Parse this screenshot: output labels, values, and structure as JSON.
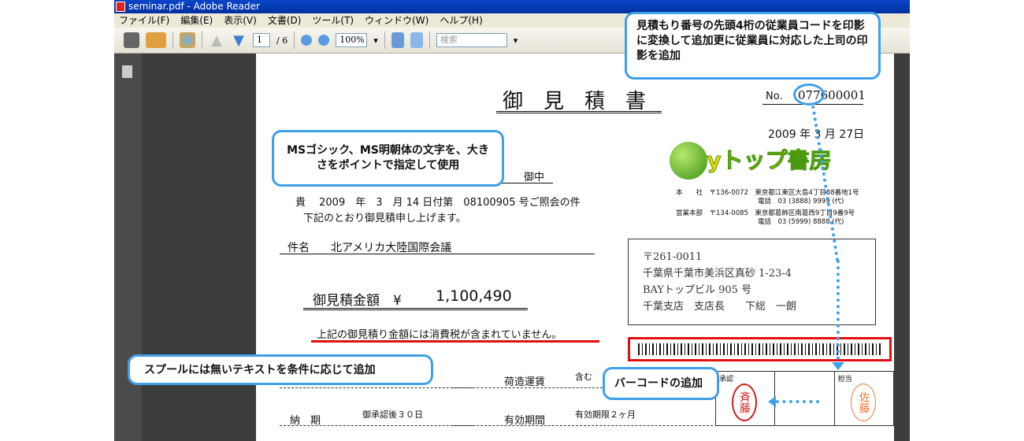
{
  "window": {
    "title": "seminar.pdf - Adobe Reader"
  },
  "menu": [
    "ファイル(F)",
    "編集(E)",
    "表示(V)",
    "文書(D)",
    "ツール(T)",
    "ウィンドウ(W)",
    "ヘルプ(H)"
  ],
  "toolbar": {
    "page_current": "1",
    "page_total": "/ 6",
    "zoom": "100%",
    "search_placeholder": "検索"
  },
  "doc": {
    "title": "御　見　積　書",
    "no_label": "No.",
    "no_value": "077600001",
    "date": "2009 年  3 月 27日",
    "recipient_suffix": "御中",
    "reference": "貴　 2009　年　3　月 14 日付第　08100905 号ご照会の件",
    "intro": "下記のとおり御見積申し上げます。",
    "subject_label": "件名",
    "subject": "北アメリカ大陸国際会議",
    "amount_label": "御見積金額　¥",
    "amount": "1,100,490",
    "tax_note": "上記の御見積り金額には消費税が含まれていません。",
    "company": {
      "logo": "Bayトップ書房",
      "hq": [
        "本　　社　〒136-0072　東京都江東区大島4丁目88番地1号",
        "電話　03 (3888) 9999 (代)"
      ],
      "sales": [
        "営業本部　〒134-0085　東京都葛飾区南葛西9丁目9番9号",
        "電話　03 (5999) 8888 (代)"
      ]
    },
    "address": [
      "〒261-0011",
      "千葉県千葉市美浜区真砂 1-23-4",
      "BAYトップビル 905 号",
      "千葉支店　支店長　　下総　一朗"
    ],
    "shipping_label": "荷造運賃",
    "shipping_value": "含む",
    "delivery_label": "納　期",
    "delivery_value": "御承認後３０日",
    "validity_label": "有効期間",
    "validity_value": "有効期限２ヶ月",
    "stamps": {
      "approve_label": "承認",
      "approve_stamp": "斉藤",
      "staff_label": "担当",
      "staff_stamp": "佐藤"
    }
  },
  "callouts": {
    "employee_code": "見積もり番号の先頭4桁の従業員コードを印影に変換して追加更に従業員に対応した上司の印影を追加",
    "fonts": "MSゴシック、MS明朝体の文字を、大きさをポイントで指定して使用",
    "spool": "スプールには無いテキストを条件に応じて追加",
    "barcode": "バーコードの追加"
  },
  "colors": {
    "callout_border": "#3fa0e8",
    "highlight": "#e01010",
    "stamp_red": "#d02020",
    "stamp_orange": "#e87a3a"
  }
}
